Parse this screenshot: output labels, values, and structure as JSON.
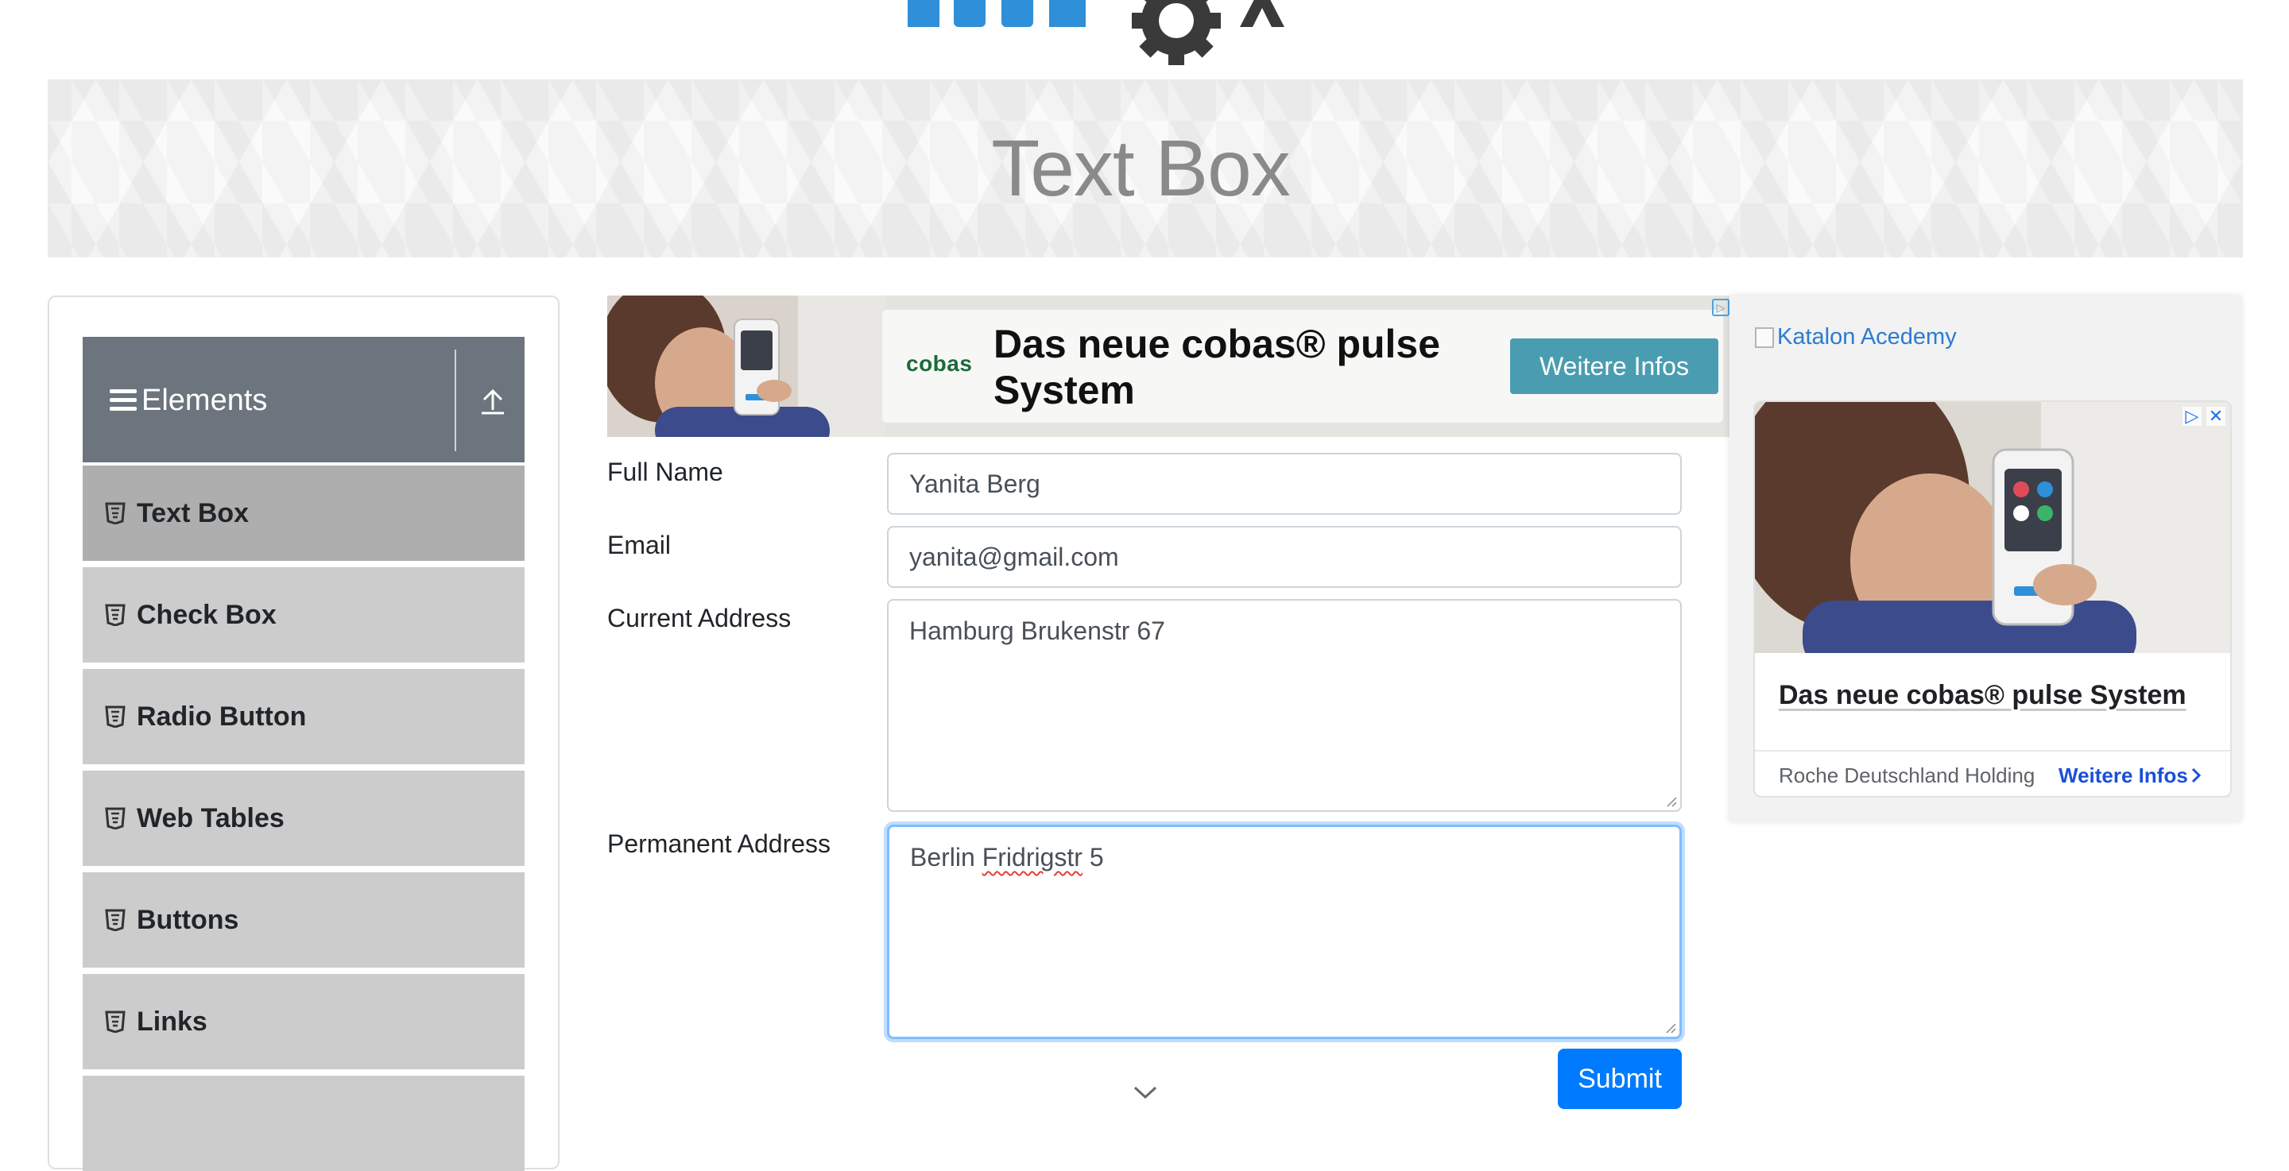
{
  "page": {
    "title": "Text Box"
  },
  "sidebar": {
    "group_title": "Elements",
    "items": [
      {
        "label": "Text Box",
        "active": true
      },
      {
        "label": "Check Box"
      },
      {
        "label": "Radio Button"
      },
      {
        "label": "Web Tables"
      },
      {
        "label": "Buttons"
      },
      {
        "label": "Links"
      }
    ]
  },
  "ad_top": {
    "brand": "cobas",
    "headline": "Das neue cobas® pulse System",
    "cta": "Weitere Infos"
  },
  "form": {
    "full_name_label": "Full Name",
    "full_name_value": "Yanita Berg",
    "email_label": "Email",
    "email_value": "yanita@gmail.com",
    "current_address_label": "Current Address",
    "current_address_value": "Hamburg Brukenstr 67",
    "permanent_address_label": "Permanent Address",
    "permanent_address_prefix": "Berlin",
    "permanent_address_misspelled": "Fridrigstr",
    "permanent_address_suffix": "5",
    "submit_label": "Submit"
  },
  "ad_right": {
    "image_alt": "Katalon Acedemy",
    "title": "Das neue cobas® pulse System",
    "advertiser": "Roche Deutschland Holding",
    "cta": "Weitere Infos"
  },
  "colors": {
    "primary": "#007bff",
    "sidebar_header": "#6c757d",
    "menu_item": "#cccccc",
    "menu_item_active": "#aeaeae",
    "focus_ring": "#80bdff"
  }
}
